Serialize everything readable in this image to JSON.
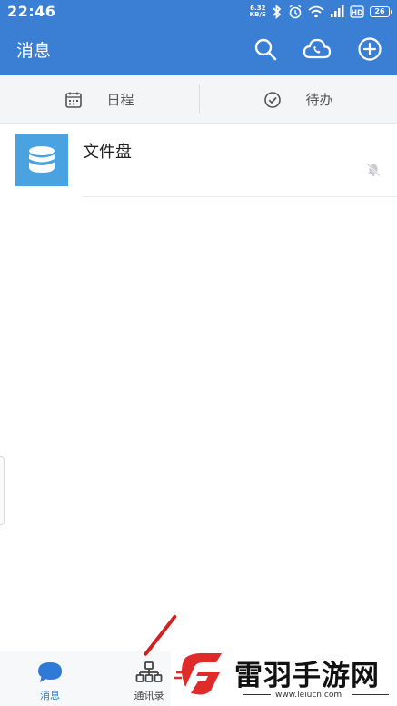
{
  "status_bar": {
    "time": "22:46",
    "net_speed_value": "6.32",
    "net_speed_unit": "KB/S",
    "battery": "26"
  },
  "header": {
    "title": "消息",
    "icons": [
      "search-icon",
      "cloud-phone-icon",
      "add-icon"
    ]
  },
  "tabs": [
    {
      "label": "日程",
      "icon": "calendar-icon"
    },
    {
      "label": "待办",
      "icon": "check-circle-icon"
    }
  ],
  "messages": [
    {
      "name": "文件盘",
      "icon": "database-icon",
      "muted": true
    }
  ],
  "bottom_nav": [
    {
      "label": "消息",
      "icon": "chat-bubble-icon",
      "active": true
    },
    {
      "label": "通讯录",
      "icon": "org-chart-icon",
      "active": false
    }
  ],
  "watermark": {
    "text": "雷羽手游网",
    "url": "www.leiucn.com"
  },
  "colors": {
    "primary": "#3b7fd4",
    "avatar": "#4aa3e0",
    "active_nav": "#2f7ad6",
    "logo_red": "#e02b2b"
  }
}
